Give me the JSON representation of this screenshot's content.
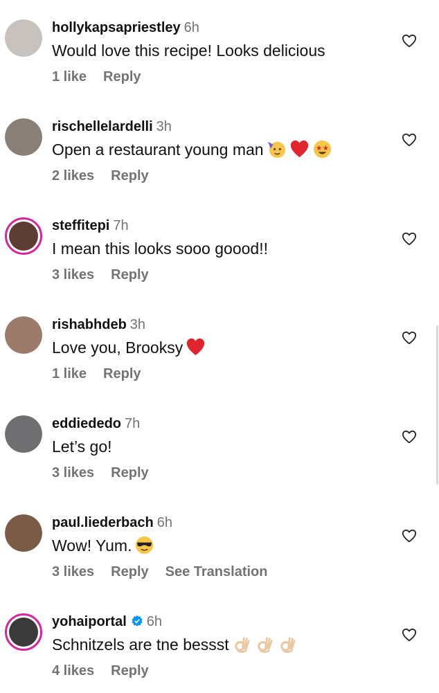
{
  "comments": [
    {
      "username": "hollykapsapriestley",
      "time": "6h",
      "text": "Would love this recipe! Looks delicious",
      "likes": "1 like",
      "reply": "Reply",
      "translation": "",
      "verified": false,
      "story": false,
      "emojis": [],
      "avatar_color": "#c7c2bd"
    },
    {
      "username": "rischellelardelli",
      "time": "3h",
      "text": "Open a restaurant young man",
      "likes": "2 likes",
      "reply": "Reply",
      "translation": "",
      "verified": false,
      "story": false,
      "emojis": [
        "partying-face-emoji",
        "red-heart-emoji",
        "star-struck-emoji"
      ],
      "avatar_color": "#8a7f76"
    },
    {
      "username": "steffitepi",
      "time": "7h",
      "text": "I mean this looks sooo goood!!",
      "likes": "3 likes",
      "reply": "Reply",
      "translation": "",
      "verified": false,
      "story": true,
      "emojis": [],
      "avatar_color": "#5b3d33"
    },
    {
      "username": "rishabhdeb",
      "time": "3h",
      "text": "Love you, Brooksy",
      "likes": "1 like",
      "reply": "Reply",
      "translation": "",
      "verified": false,
      "story": false,
      "emojis": [
        "red-heart-emoji"
      ],
      "avatar_color": "#9c7a6b"
    },
    {
      "username": "eddiededo",
      "time": "7h",
      "text": "Let’s go!",
      "likes": "3 likes",
      "reply": "Reply",
      "translation": "",
      "verified": false,
      "story": false,
      "emojis": [],
      "avatar_color": "#6f6f72"
    },
    {
      "username": "paul.liederbach",
      "time": "6h",
      "text": "Wow! Yum.",
      "likes": "3 likes",
      "reply": "Reply",
      "translation": "See Translation",
      "verified": false,
      "story": false,
      "emojis": [
        "sunglasses-face-emoji"
      ],
      "avatar_color": "#7a5b45"
    },
    {
      "username": "yohaiportal",
      "time": "6h",
      "text": "Schnitzels are tne bessst",
      "likes": "4 likes",
      "reply": "Reply",
      "translation": "",
      "verified": true,
      "story": true,
      "emojis": [
        "ok-hand-emoji",
        "ok-hand-emoji",
        "ok-hand-emoji"
      ],
      "avatar_color": "#3a3a3a"
    }
  ],
  "colors": {
    "secondary_text": "#737373",
    "verified_blue": "#0095f6",
    "story_ring": "#d6249f"
  }
}
